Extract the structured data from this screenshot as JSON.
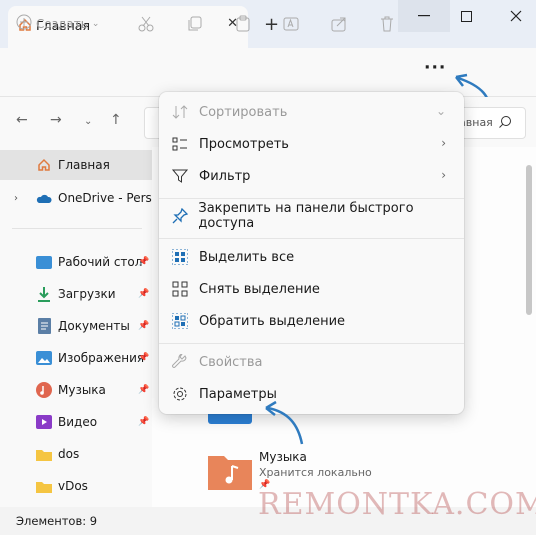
{
  "tab": {
    "title": "Главная"
  },
  "toolbar": {
    "create_label": "Создать",
    "more_label": "···"
  },
  "search": {
    "partial_text": "лавная"
  },
  "sidebar": {
    "items": [
      {
        "label": "Главная"
      },
      {
        "label": "OneDrive - Person"
      },
      {
        "label": "Рабочий стол"
      },
      {
        "label": "Загрузки"
      },
      {
        "label": "Документы"
      },
      {
        "label": "Изображения"
      },
      {
        "label": "Музыка"
      },
      {
        "label": "Видео"
      },
      {
        "label": "dos"
      },
      {
        "label": "vDos"
      }
    ]
  },
  "content": {
    "music_card": {
      "title": "Музыка",
      "subtitle": "Хранится локально"
    }
  },
  "status": {
    "count_text": "Элементов: 9"
  },
  "menu": {
    "items": [
      {
        "label": "Сортировать",
        "disabled": true
      },
      {
        "label": "Просмотреть"
      },
      {
        "label": "Фильтр"
      },
      {
        "label": "Закрепить на панели быстрого доступа"
      },
      {
        "label": "Выделить все"
      },
      {
        "label": "Снять выделение"
      },
      {
        "label": "Обратить выделение"
      },
      {
        "label": "Свойства",
        "disabled": true
      },
      {
        "label": "Параметры"
      }
    ]
  },
  "watermark": {
    "text": "REMONTKA.COM"
  },
  "colors": {
    "accent": "#1f6fb5",
    "arrow": "#2f7bbf",
    "folder": "#f5c542",
    "music_folder": "#f4a460"
  }
}
